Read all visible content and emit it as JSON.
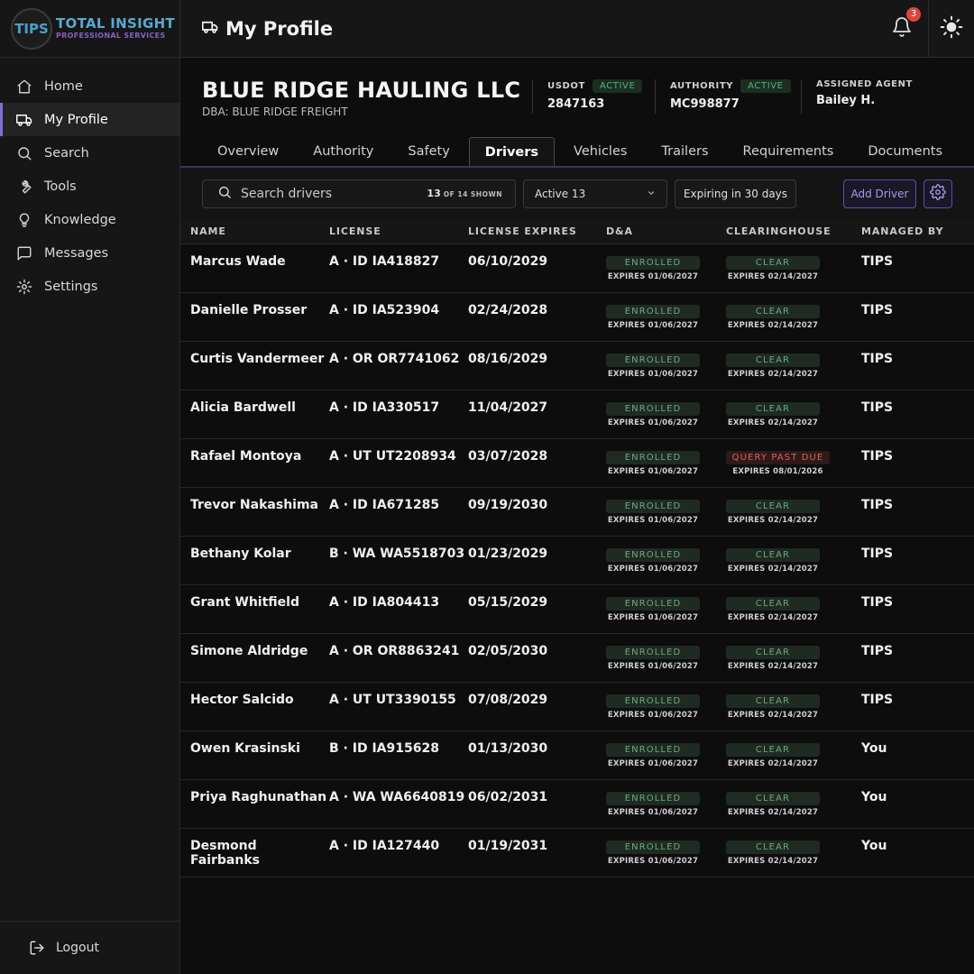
{
  "brand": {
    "badge": "TIPS",
    "line1": "TOTAL INSIGHT",
    "line2": "PROFESSIONAL SERVICES"
  },
  "nav": [
    {
      "label": "Home",
      "icon": "home-icon"
    },
    {
      "label": "My Profile",
      "icon": "truck-icon",
      "active": true
    },
    {
      "label": "Search",
      "icon": "search-icon"
    },
    {
      "label": "Tools",
      "icon": "wrench-icon"
    },
    {
      "label": "Knowledge",
      "icon": "lightbulb-icon"
    },
    {
      "label": "Messages",
      "icon": "chat-icon"
    },
    {
      "label": "Settings",
      "icon": "gear-icon"
    }
  ],
  "logout": "Logout",
  "header": {
    "title": "My Profile",
    "notifications": "3"
  },
  "company": {
    "name": "BLUE RIDGE HAULING LLC",
    "dba": "DBA: BLUE RIDGE FREIGHT",
    "usdot_label": "USDOT",
    "usdot_status": "ACTIVE",
    "usdot": "2847163",
    "authority_label": "AUTHORITY",
    "authority_status": "ACTIVE",
    "authority": "MC998877",
    "agent_label": "ASSIGNED AGENT",
    "agent": "Bailey H."
  },
  "tabs": [
    "Overview",
    "Authority",
    "Safety",
    "Drivers",
    "Vehicles",
    "Trailers",
    "Requirements",
    "Documents"
  ],
  "active_tab": "Drivers",
  "toolbar": {
    "search_placeholder": "Search drivers",
    "count": "13",
    "count_suffix": "OF 14 SHOWN",
    "filter": "Active 13",
    "expiring": "Expiring in 30 days",
    "add": "Add Driver"
  },
  "columns": [
    "NAME",
    "LICENSE",
    "LICENSE EXPIRES",
    "D&A",
    "CLEARINGHOUSE",
    "MANAGED BY"
  ],
  "colors": {
    "accent": "#7c6fd6",
    "ok": "#6ba881",
    "danger": "#d8625a"
  },
  "drivers": [
    {
      "name": "Marcus Wade",
      "license": "A · ID IA418827",
      "expires": "06/10/2029",
      "da": "ENROLLED",
      "da_exp": "EXPIRES 01/06/2027",
      "ch": "CLEAR",
      "ch_exp": "EXPIRES 02/14/2027",
      "ch_bad": false,
      "managed": "TIPS"
    },
    {
      "name": "Danielle Prosser",
      "license": "A · ID IA523904",
      "expires": "02/24/2028",
      "da": "ENROLLED",
      "da_exp": "EXPIRES 01/06/2027",
      "ch": "CLEAR",
      "ch_exp": "EXPIRES 02/14/2027",
      "ch_bad": false,
      "managed": "TIPS"
    },
    {
      "name": "Curtis Vandermeer",
      "license": "A · OR OR7741062",
      "expires": "08/16/2029",
      "da": "ENROLLED",
      "da_exp": "EXPIRES 01/06/2027",
      "ch": "CLEAR",
      "ch_exp": "EXPIRES 02/14/2027",
      "ch_bad": false,
      "managed": "TIPS"
    },
    {
      "name": "Alicia Bardwell",
      "license": "A · ID IA330517",
      "expires": "11/04/2027",
      "da": "ENROLLED",
      "da_exp": "EXPIRES 01/06/2027",
      "ch": "CLEAR",
      "ch_exp": "EXPIRES 02/14/2027",
      "ch_bad": false,
      "managed": "TIPS"
    },
    {
      "name": "Rafael Montoya",
      "license": "A · UT UT2208934",
      "expires": "03/07/2028",
      "da": "ENROLLED",
      "da_exp": "EXPIRES 01/06/2027",
      "ch": "QUERY PAST DUE",
      "ch_exp": "EXPIRES 08/01/2026",
      "ch_bad": true,
      "managed": "TIPS"
    },
    {
      "name": "Trevor Nakashima",
      "license": "A · ID IA671285",
      "expires": "09/19/2030",
      "da": "ENROLLED",
      "da_exp": "EXPIRES 01/06/2027",
      "ch": "CLEAR",
      "ch_exp": "EXPIRES 02/14/2027",
      "ch_bad": false,
      "managed": "TIPS"
    },
    {
      "name": "Bethany Kolar",
      "license": "B · WA WA5518703",
      "expires": "01/23/2029",
      "da": "ENROLLED",
      "da_exp": "EXPIRES 01/06/2027",
      "ch": "CLEAR",
      "ch_exp": "EXPIRES 02/14/2027",
      "ch_bad": false,
      "managed": "TIPS"
    },
    {
      "name": "Grant Whitfield",
      "license": "A · ID IA804413",
      "expires": "05/15/2029",
      "da": "ENROLLED",
      "da_exp": "EXPIRES 01/06/2027",
      "ch": "CLEAR",
      "ch_exp": "EXPIRES 02/14/2027",
      "ch_bad": false,
      "managed": "TIPS"
    },
    {
      "name": "Simone Aldridge",
      "license": "A · OR OR8863241",
      "expires": "02/05/2030",
      "da": "ENROLLED",
      "da_exp": "EXPIRES 01/06/2027",
      "ch": "CLEAR",
      "ch_exp": "EXPIRES 02/14/2027",
      "ch_bad": false,
      "managed": "TIPS"
    },
    {
      "name": "Hector Salcido",
      "license": "A · UT UT3390155",
      "expires": "07/08/2029",
      "da": "ENROLLED",
      "da_exp": "EXPIRES 01/06/2027",
      "ch": "CLEAR",
      "ch_exp": "EXPIRES 02/14/2027",
      "ch_bad": false,
      "managed": "TIPS"
    },
    {
      "name": "Owen Krasinski",
      "license": "B · ID IA915628",
      "expires": "01/13/2030",
      "da": "ENROLLED",
      "da_exp": "EXPIRES 01/06/2027",
      "ch": "CLEAR",
      "ch_exp": "EXPIRES 02/14/2027",
      "ch_bad": false,
      "managed": "You"
    },
    {
      "name": "Priya Raghunathan",
      "license": "A · WA WA6640819",
      "expires": "06/02/2031",
      "da": "ENROLLED",
      "da_exp": "EXPIRES 01/06/2027",
      "ch": "CLEAR",
      "ch_exp": "EXPIRES 02/14/2027",
      "ch_bad": false,
      "managed": "You"
    },
    {
      "name": "Desmond Fairbanks",
      "license": "A · ID IA127440",
      "expires": "01/19/2031",
      "da": "ENROLLED",
      "da_exp": "EXPIRES 01/06/2027",
      "ch": "CLEAR",
      "ch_exp": "EXPIRES 02/14/2027",
      "ch_bad": false,
      "managed": "You"
    }
  ]
}
